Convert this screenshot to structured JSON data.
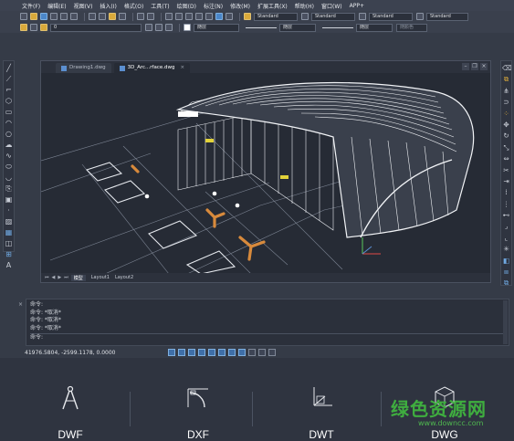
{
  "menu": {
    "items": [
      "文件(F)",
      "编辑(E)",
      "视图(V)",
      "插入(I)",
      "格式(O)",
      "工具(T)",
      "绘图(D)",
      "标注(N)",
      "修改(M)",
      "扩展工具(X)",
      "帮助(H)",
      "窗口(W)",
      "APP+"
    ]
  },
  "toolbar": {
    "text_style": "Standard",
    "dim_style": "Standard",
    "table_style": "Standard",
    "multileader_style": "Standard",
    "layer_value": "0",
    "color_value": "随层",
    "linetype_value": "随层",
    "lineweight_value": "随层",
    "plotstyle_value": "随颜色"
  },
  "tabs": [
    {
      "label": "Drawing1.dwg",
      "active": false
    },
    {
      "label": "3D_Arc...rface.dwg",
      "active": true
    }
  ],
  "layout_tabs": [
    "模型",
    "Layout1",
    "Layout2"
  ],
  "command": {
    "lines": [
      "命令:",
      "命令: *取消*",
      "命令: *取消*",
      "命令: *取消*"
    ],
    "prompt": "命令:"
  },
  "status": {
    "coords": "41976.5804, -2599.1178, 0.0000"
  },
  "formats": [
    {
      "label": "DWF",
      "icon": "compass-icon"
    },
    {
      "label": "DXF",
      "icon": "arc-dimension-icon"
    },
    {
      "label": "DWT",
      "icon": "3d-axes-icon"
    },
    {
      "label": "DWG",
      "icon": "3d-cube-icon"
    }
  ],
  "watermark": {
    "text": "绿色资源网",
    "url": "www.downcc.com",
    "color": "#3fae3f"
  },
  "colors": {
    "background": "#353b47",
    "canvas": "#262b35",
    "accent": "#4a86c8"
  }
}
